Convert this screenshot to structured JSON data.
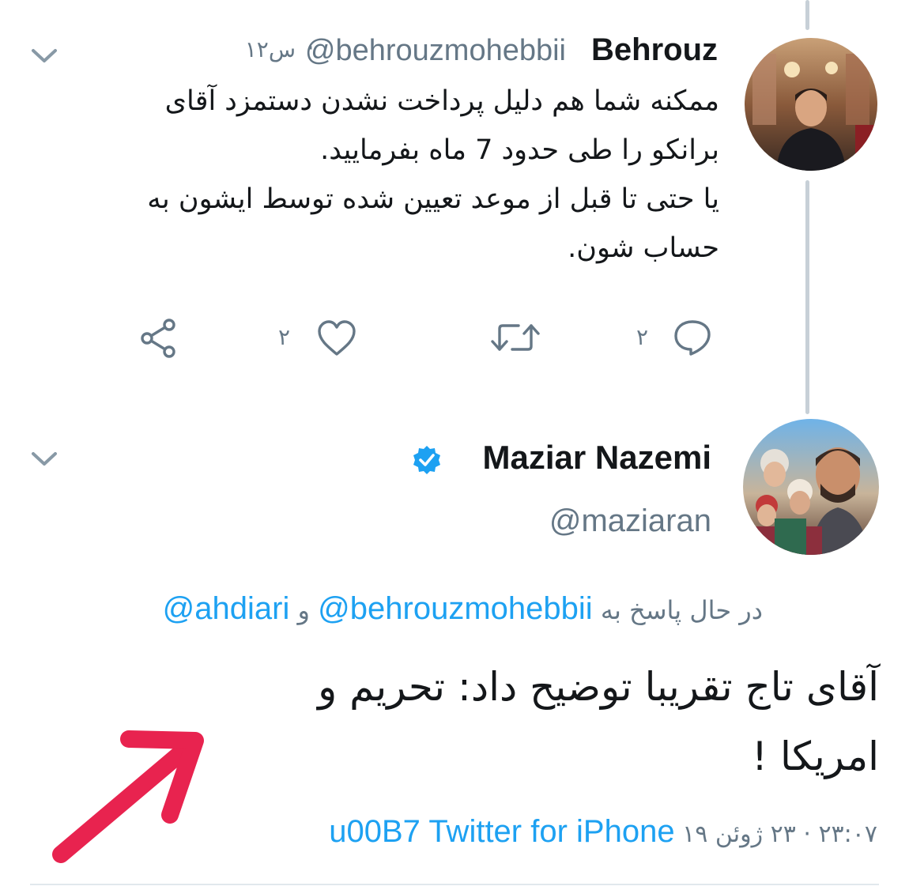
{
  "tweet1": {
    "display_name": "Behrouz",
    "handle": "@behrouzmohebbii",
    "separator": "·",
    "time": "۱۲س",
    "body_lines": [
      "ممکنه شما هم دلیل پرداخت نشدن دستمزد آقای",
      "برانکو را طی حدود 7 ماه بفرمایید.",
      "یا حتی تا قبل از موعد تعیین شده توسط ایشون به",
      "حساب شون."
    ],
    "actions": {
      "reply_count": "۲",
      "like_count": "۲"
    },
    "icons": {
      "menu": "chevron-down-icon",
      "reply": "reply-icon",
      "retweet": "retweet-icon",
      "like": "heart-icon",
      "share": "share-icon"
    }
  },
  "tweet2": {
    "display_name": "Maziar Nazemi",
    "handle": "@maziaran",
    "verified_icon": "verified-badge-icon",
    "reply_prefix": "در حال پاسخ به",
    "reply_user1": "@behrouzmohebbii",
    "reply_and": "و",
    "reply_user2": "@ahdiari",
    "body_lines": [
      "آقای تاج تقریبا توضیح داد: تحریم و",
      "امریکا !"
    ],
    "timestamp": "۲۳:۰۷ · ۲۳ ژوئن ۱۹",
    "separator_code": "u00B7",
    "source": "Twitter for iPhone"
  },
  "colors": {
    "accent": "#1da1f2",
    "secondary_text": "#657786",
    "thread_line": "#c7d0d7",
    "verified": "#1da1f2",
    "annotation_arrow": "#e8234f"
  },
  "annotation": {
    "icon": "arrow-annotation-icon"
  }
}
